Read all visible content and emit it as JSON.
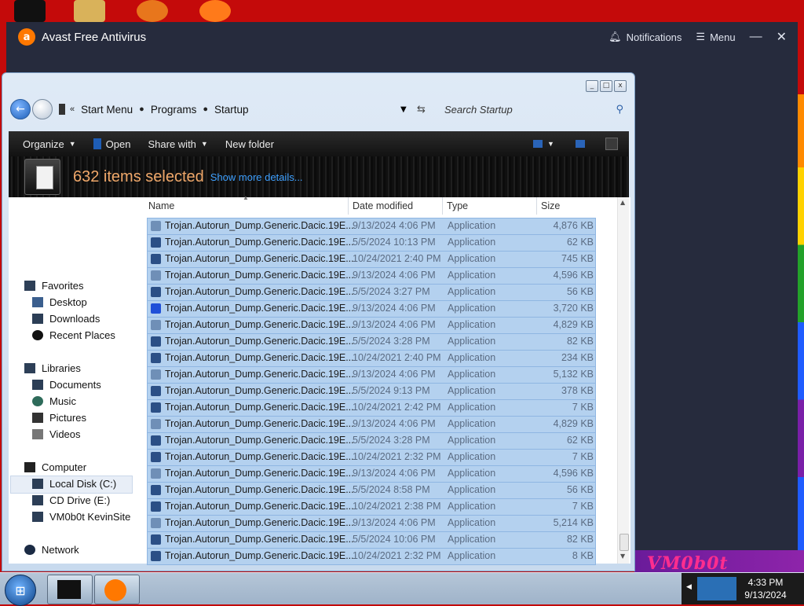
{
  "avast": {
    "title": "Avast Free Antivirus",
    "notifications": "Notifications",
    "menu": "Menu",
    "minimize": "—",
    "close": "✕"
  },
  "explorer": {
    "breadcrumb": [
      "Start Menu",
      "Programs",
      "Startup"
    ],
    "search_placeholder": "Search Startup",
    "toolbar": {
      "organize": "Organize",
      "open": "Open",
      "share_with": "Share with",
      "new_folder": "New folder"
    },
    "details": {
      "count_text": "632 items selected",
      "more_link": "Show more details..."
    },
    "nav": {
      "favorites": "Favorites",
      "desktop": "Desktop",
      "downloads": "Downloads",
      "recent": "Recent Places",
      "libraries": "Libraries",
      "documents": "Documents",
      "music": "Music",
      "pictures": "Pictures",
      "videos": "Videos",
      "computer": "Computer",
      "local_disk": "Local Disk (C:)",
      "cd_drive": "CD Drive (E:)",
      "vm_site": "VM0b0t KevinSite",
      "network": "Network"
    },
    "columns": {
      "name": "Name",
      "date": "Date modified",
      "type": "Type",
      "size": "Size"
    },
    "files": [
      {
        "name": "Trojan.Autorun_Dump.Generic.Dacic.19E...",
        "date": "9/13/2024 4:06 PM",
        "type": "Application",
        "size": "4,876 KB",
        "icon": "gear-app-icon"
      },
      {
        "name": "Trojan.Autorun_Dump.Generic.Dacic.19E...",
        "date": "5/5/2024 10:13 PM",
        "type": "Application",
        "size": "62 KB",
        "icon": "window-app-icon"
      },
      {
        "name": "Trojan.Autorun_Dump.Generic.Dacic.19E...",
        "date": "10/24/2021 2:40 PM",
        "type": "Application",
        "size": "745 KB",
        "icon": "window-app-icon"
      },
      {
        "name": "Trojan.Autorun_Dump.Generic.Dacic.19E...",
        "date": "9/13/2024 4:06 PM",
        "type": "Application",
        "size": "4,596 KB",
        "icon": "gear-app-icon"
      },
      {
        "name": "Trojan.Autorun_Dump.Generic.Dacic.19E...",
        "date": "5/5/2024 3:27 PM",
        "type": "Application",
        "size": "56 KB",
        "icon": "window-app-icon"
      },
      {
        "name": "Trojan.Autorun_Dump.Generic.Dacic.19E...",
        "date": "9/13/2024 4:06 PM",
        "type": "Application",
        "size": "3,720 KB",
        "icon": "music-app-icon"
      },
      {
        "name": "Trojan.Autorun_Dump.Generic.Dacic.19E...",
        "date": "9/13/2024 4:06 PM",
        "type": "Application",
        "size": "4,829 KB",
        "icon": "gear-app-icon"
      },
      {
        "name": "Trojan.Autorun_Dump.Generic.Dacic.19E...",
        "date": "5/5/2024 3:28 PM",
        "type": "Application",
        "size": "82 KB",
        "icon": "window-app-icon"
      },
      {
        "name": "Trojan.Autorun_Dump.Generic.Dacic.19E...",
        "date": "10/24/2021 2:40 PM",
        "type": "Application",
        "size": "234 KB",
        "icon": "window-app-icon"
      },
      {
        "name": "Trojan.Autorun_Dump.Generic.Dacic.19E...",
        "date": "9/13/2024 4:06 PM",
        "type": "Application",
        "size": "5,132 KB",
        "icon": "gear-app-icon"
      },
      {
        "name": "Trojan.Autorun_Dump.Generic.Dacic.19E...",
        "date": "5/5/2024 9:13 PM",
        "type": "Application",
        "size": "378 KB",
        "icon": "window-app-icon"
      },
      {
        "name": "Trojan.Autorun_Dump.Generic.Dacic.19E...",
        "date": "10/24/2021 2:42 PM",
        "type": "Application",
        "size": "7 KB",
        "icon": "window-app-icon"
      },
      {
        "name": "Trojan.Autorun_Dump.Generic.Dacic.19E...",
        "date": "9/13/2024 4:06 PM",
        "type": "Application",
        "size": "4,829 KB",
        "icon": "gear-app-icon"
      },
      {
        "name": "Trojan.Autorun_Dump.Generic.Dacic.19E...",
        "date": "5/5/2024 3:28 PM",
        "type": "Application",
        "size": "62 KB",
        "icon": "window-app-icon"
      },
      {
        "name": "Trojan.Autorun_Dump.Generic.Dacic.19E...",
        "date": "10/24/2021 2:32 PM",
        "type": "Application",
        "size": "7 KB",
        "icon": "window-app-icon"
      },
      {
        "name": "Trojan.Autorun_Dump.Generic.Dacic.19E...",
        "date": "9/13/2024 4:06 PM",
        "type": "Application",
        "size": "4,596 KB",
        "icon": "gear-app-icon"
      },
      {
        "name": "Trojan.Autorun_Dump.Generic.Dacic.19E...",
        "date": "5/5/2024 8:58 PM",
        "type": "Application",
        "size": "56 KB",
        "icon": "window-app-icon"
      },
      {
        "name": "Trojan.Autorun_Dump.Generic.Dacic.19E...",
        "date": "10/24/2021 2:38 PM",
        "type": "Application",
        "size": "7 KB",
        "icon": "window-app-icon"
      },
      {
        "name": "Trojan.Autorun_Dump.Generic.Dacic.19E...",
        "date": "9/13/2024 4:06 PM",
        "type": "Application",
        "size": "5,214 KB",
        "icon": "gear-app-icon"
      },
      {
        "name": "Trojan.Autorun_Dump.Generic.Dacic.19E...",
        "date": "5/5/2024 10:06 PM",
        "type": "Application",
        "size": "82 KB",
        "icon": "window-app-icon"
      },
      {
        "name": "Trojan.Autorun_Dump.Generic.Dacic.19E...",
        "date": "10/24/2021 2:32 PM",
        "type": "Application",
        "size": "8 KB",
        "icon": "window-app-icon"
      }
    ]
  },
  "desktop": {
    "logo_text": "VM0b0t"
  },
  "taskbar": {
    "time": "4:33 PM",
    "date": "9/13/2024"
  },
  "colors": {
    "desktop_bg": "#c40a0a",
    "avast_bg": "#262b3d",
    "avast_orange": "#ff7800",
    "selection": "#b4d1ef",
    "selected_count": "#f0a86a",
    "link": "#3ea0ff"
  }
}
